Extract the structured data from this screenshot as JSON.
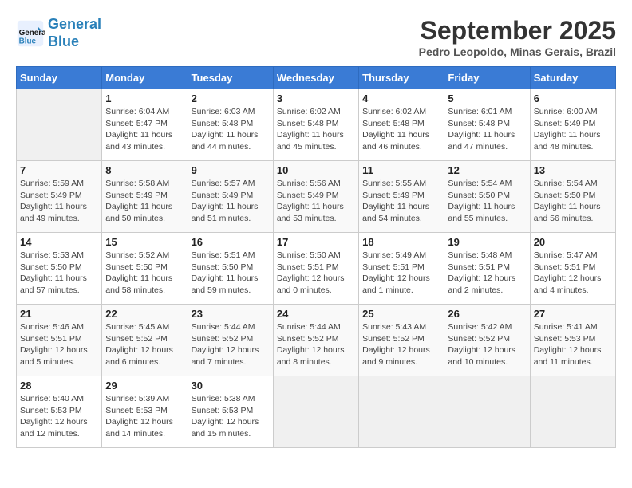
{
  "header": {
    "logo_line1": "General",
    "logo_line2": "Blue",
    "month": "September 2025",
    "location": "Pedro Leopoldo, Minas Gerais, Brazil"
  },
  "columns": [
    "Sunday",
    "Monday",
    "Tuesday",
    "Wednesday",
    "Thursday",
    "Friday",
    "Saturday"
  ],
  "weeks": [
    [
      {
        "num": "",
        "info": ""
      },
      {
        "num": "1",
        "info": "Sunrise: 6:04 AM\nSunset: 5:47 PM\nDaylight: 11 hours\nand 43 minutes."
      },
      {
        "num": "2",
        "info": "Sunrise: 6:03 AM\nSunset: 5:48 PM\nDaylight: 11 hours\nand 44 minutes."
      },
      {
        "num": "3",
        "info": "Sunrise: 6:02 AM\nSunset: 5:48 PM\nDaylight: 11 hours\nand 45 minutes."
      },
      {
        "num": "4",
        "info": "Sunrise: 6:02 AM\nSunset: 5:48 PM\nDaylight: 11 hours\nand 46 minutes."
      },
      {
        "num": "5",
        "info": "Sunrise: 6:01 AM\nSunset: 5:48 PM\nDaylight: 11 hours\nand 47 minutes."
      },
      {
        "num": "6",
        "info": "Sunrise: 6:00 AM\nSunset: 5:49 PM\nDaylight: 11 hours\nand 48 minutes."
      }
    ],
    [
      {
        "num": "7",
        "info": "Sunrise: 5:59 AM\nSunset: 5:49 PM\nDaylight: 11 hours\nand 49 minutes."
      },
      {
        "num": "8",
        "info": "Sunrise: 5:58 AM\nSunset: 5:49 PM\nDaylight: 11 hours\nand 50 minutes."
      },
      {
        "num": "9",
        "info": "Sunrise: 5:57 AM\nSunset: 5:49 PM\nDaylight: 11 hours\nand 51 minutes."
      },
      {
        "num": "10",
        "info": "Sunrise: 5:56 AM\nSunset: 5:49 PM\nDaylight: 11 hours\nand 53 minutes."
      },
      {
        "num": "11",
        "info": "Sunrise: 5:55 AM\nSunset: 5:49 PM\nDaylight: 11 hours\nand 54 minutes."
      },
      {
        "num": "12",
        "info": "Sunrise: 5:54 AM\nSunset: 5:50 PM\nDaylight: 11 hours\nand 55 minutes."
      },
      {
        "num": "13",
        "info": "Sunrise: 5:54 AM\nSunset: 5:50 PM\nDaylight: 11 hours\nand 56 minutes."
      }
    ],
    [
      {
        "num": "14",
        "info": "Sunrise: 5:53 AM\nSunset: 5:50 PM\nDaylight: 11 hours\nand 57 minutes."
      },
      {
        "num": "15",
        "info": "Sunrise: 5:52 AM\nSunset: 5:50 PM\nDaylight: 11 hours\nand 58 minutes."
      },
      {
        "num": "16",
        "info": "Sunrise: 5:51 AM\nSunset: 5:50 PM\nDaylight: 11 hours\nand 59 minutes."
      },
      {
        "num": "17",
        "info": "Sunrise: 5:50 AM\nSunset: 5:51 PM\nDaylight: 12 hours\nand 0 minutes."
      },
      {
        "num": "18",
        "info": "Sunrise: 5:49 AM\nSunset: 5:51 PM\nDaylight: 12 hours\nand 1 minute."
      },
      {
        "num": "19",
        "info": "Sunrise: 5:48 AM\nSunset: 5:51 PM\nDaylight: 12 hours\nand 2 minutes."
      },
      {
        "num": "20",
        "info": "Sunrise: 5:47 AM\nSunset: 5:51 PM\nDaylight: 12 hours\nand 4 minutes."
      }
    ],
    [
      {
        "num": "21",
        "info": "Sunrise: 5:46 AM\nSunset: 5:51 PM\nDaylight: 12 hours\nand 5 minutes."
      },
      {
        "num": "22",
        "info": "Sunrise: 5:45 AM\nSunset: 5:52 PM\nDaylight: 12 hours\nand 6 minutes."
      },
      {
        "num": "23",
        "info": "Sunrise: 5:44 AM\nSunset: 5:52 PM\nDaylight: 12 hours\nand 7 minutes."
      },
      {
        "num": "24",
        "info": "Sunrise: 5:44 AM\nSunset: 5:52 PM\nDaylight: 12 hours\nand 8 minutes."
      },
      {
        "num": "25",
        "info": "Sunrise: 5:43 AM\nSunset: 5:52 PM\nDaylight: 12 hours\nand 9 minutes."
      },
      {
        "num": "26",
        "info": "Sunrise: 5:42 AM\nSunset: 5:52 PM\nDaylight: 12 hours\nand 10 minutes."
      },
      {
        "num": "27",
        "info": "Sunrise: 5:41 AM\nSunset: 5:53 PM\nDaylight: 12 hours\nand 11 minutes."
      }
    ],
    [
      {
        "num": "28",
        "info": "Sunrise: 5:40 AM\nSunset: 5:53 PM\nDaylight: 12 hours\nand 12 minutes."
      },
      {
        "num": "29",
        "info": "Sunrise: 5:39 AM\nSunset: 5:53 PM\nDaylight: 12 hours\nand 14 minutes."
      },
      {
        "num": "30",
        "info": "Sunrise: 5:38 AM\nSunset: 5:53 PM\nDaylight: 12 hours\nand 15 minutes."
      },
      {
        "num": "",
        "info": ""
      },
      {
        "num": "",
        "info": ""
      },
      {
        "num": "",
        "info": ""
      },
      {
        "num": "",
        "info": ""
      }
    ]
  ]
}
